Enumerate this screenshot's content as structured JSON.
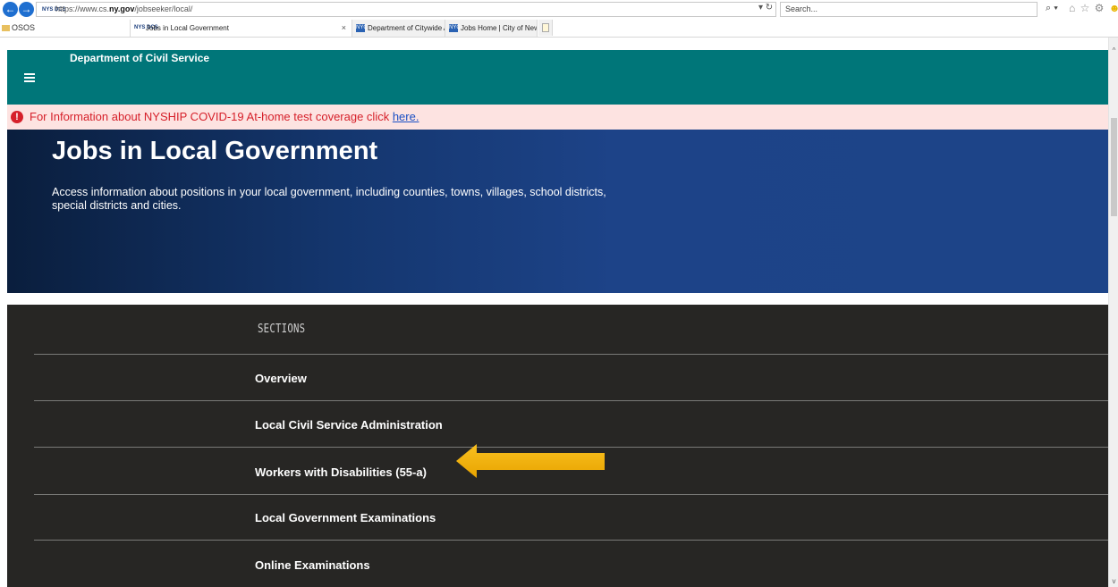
{
  "browser": {
    "address": {
      "favicon_text": "NYS DCS",
      "url_prefix": "https://www.cs.",
      "url_host": "ny.gov",
      "url_path": "/jobseeker/local/"
    },
    "refresh_symbol": "▾ ↻",
    "search_placeholder": "Search...",
    "search_symbol": "⌕ ▾",
    "toolbar_icons": "⌂ ☆ ⚙",
    "smiley": "☻",
    "favorites": [
      {
        "label": "OSOS"
      }
    ],
    "tabs": [
      {
        "favicon_text": "NYS DCS",
        "title": "Jobs in Local Government",
        "close": "×",
        "active": true
      },
      {
        "favicon_text": "NYC",
        "title": "Department of Citywide Admi...",
        "active": false
      },
      {
        "favicon_text": "NYC",
        "title": "Jobs Home | City of New York",
        "active": false
      }
    ]
  },
  "header": {
    "title": "Department of Civil Service"
  },
  "alert": {
    "icon": "!",
    "text": "For Information about NYSHIP COVID-19 At-home test coverage click ",
    "link_text": "here."
  },
  "hero": {
    "title": "Jobs in Local Government",
    "description": "Access information about positions in your local government, including counties, towns, villages, school districts, special districts and cities."
  },
  "sections": {
    "heading": "SECTIONS",
    "items": [
      {
        "label": "Overview"
      },
      {
        "label": "Local Civil Service Administration"
      },
      {
        "label": "Workers with Disabilities (55-a)"
      },
      {
        "label": "Local Government Examinations"
      },
      {
        "label": "Online Examinations"
      }
    ]
  },
  "scrollbar": {
    "up": "^",
    "down": "v"
  },
  "colors": {
    "header_teal": "#007679",
    "alert_bg": "#fde3e1",
    "alert_text": "#d6202a",
    "hero_dark": "#0a1e3d",
    "hero_blue": "#1d4488",
    "sections_bg": "#272624",
    "arrow": "#f5b700"
  }
}
